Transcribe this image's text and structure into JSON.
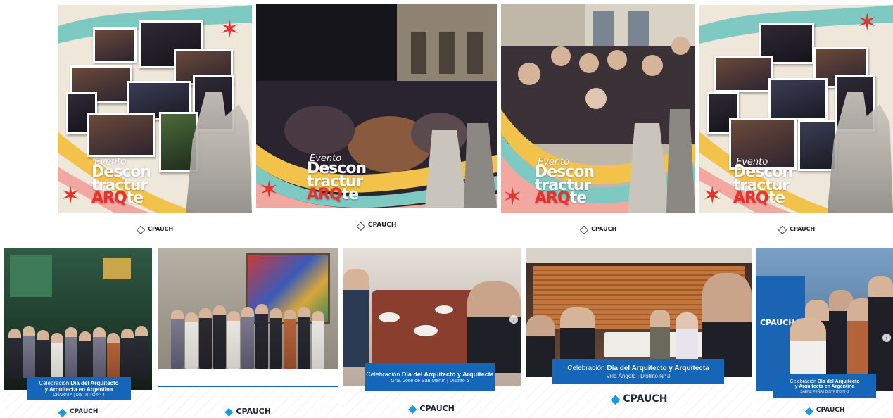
{
  "event_cards": [
    {
      "evento": "Evento",
      "line1": "Descon",
      "line2": "tractur",
      "arq": "ARQ",
      "te": "te",
      "brand": "CPAUCH"
    },
    {
      "evento": "Evento",
      "line1": "Descon",
      "line2": "tractur",
      "arq": "ARQ",
      "te": "te",
      "brand": "CPAUCH"
    },
    {
      "evento": "Evento",
      "line1": "Descon",
      "line2": "tractur",
      "arq": "ARQ",
      "te": "te",
      "brand": "CPAUCH"
    },
    {
      "evento": "Evento",
      "line1": "Descon",
      "line2": "tractur",
      "arq": "ARQ",
      "te": "te",
      "brand": "CPAUCH"
    }
  ],
  "celebration_cards": [
    {
      "pre": "Celebración ",
      "bold": "Día del Arquitecto",
      "line2": "y Arquitecta en Argentina",
      "sub": "CHARATA | DISTRITO Nº 4",
      "brand": "CPAUCH"
    },
    {
      "brand": "CPAUCH"
    },
    {
      "pre": "Celebración ",
      "bold": "Día del Arquitecto y Arquitecta",
      "sub": "Gral. José de San Martín | Distrito 6",
      "brand": "CPAUCH"
    },
    {
      "pre": "Celebración ",
      "bold": "Día del Arquitecto y Arquitecta",
      "sub": "Villa Ángela | Distrito Nº 3",
      "brand": "CPAUCH"
    },
    {
      "pre": "Celebración ",
      "bold": "Día del Arquitecto",
      "line2": "y Arquitecta en Argentina",
      "sub": "SÁENZ PEÑA | DISTRITO Nº 2",
      "brand": "CPAUCH",
      "sign": "CPAUCH"
    }
  ],
  "colors": {
    "accent_red": "#e8312c",
    "brand_blue": "#1565b8",
    "teal": "#7fc9c3",
    "yellow": "#f3c24b"
  },
  "icons": {
    "brand_logo": "cpauch-logo-icon",
    "carousel_next": "chevron-right-icon"
  }
}
